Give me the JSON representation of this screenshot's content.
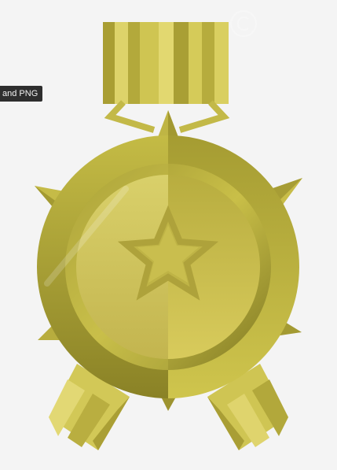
{
  "tooltip": {
    "text": "and PNG"
  },
  "medal": {
    "icon": "star-icon",
    "colors": {
      "gold_light": "#d9cf5a",
      "gold_mid": "#bfb443",
      "gold_dark": "#8b8226",
      "gold_shadow": "#6f6a20",
      "background": "#f4f4f4"
    }
  },
  "watermark": {
    "icon": "copyright-icon"
  }
}
